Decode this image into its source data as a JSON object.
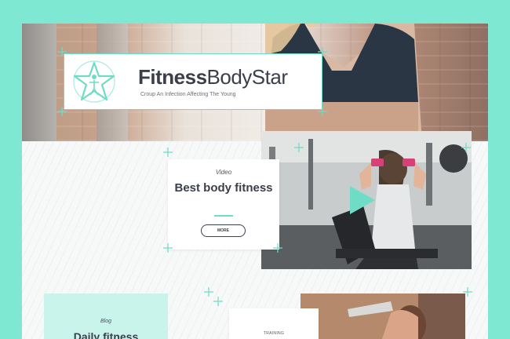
{
  "brand": {
    "name_bold": "Fitness",
    "name_rest": "BodyStar",
    "tagline": "Croup An Infection Affecting The Young",
    "logo_icon": "star-icon"
  },
  "video_card": {
    "kicker": "Video",
    "title": "Best body fitness",
    "button_label": "MORE",
    "play_icon": "play-icon"
  },
  "blog_card": {
    "kicker": "Blog",
    "title": "Daily fitness"
  },
  "training_card": {
    "kicker": "TRAINING"
  },
  "colors": {
    "accent": "#6fdcc5",
    "background": "#7ee8d2",
    "heading": "#3a3f4a"
  }
}
